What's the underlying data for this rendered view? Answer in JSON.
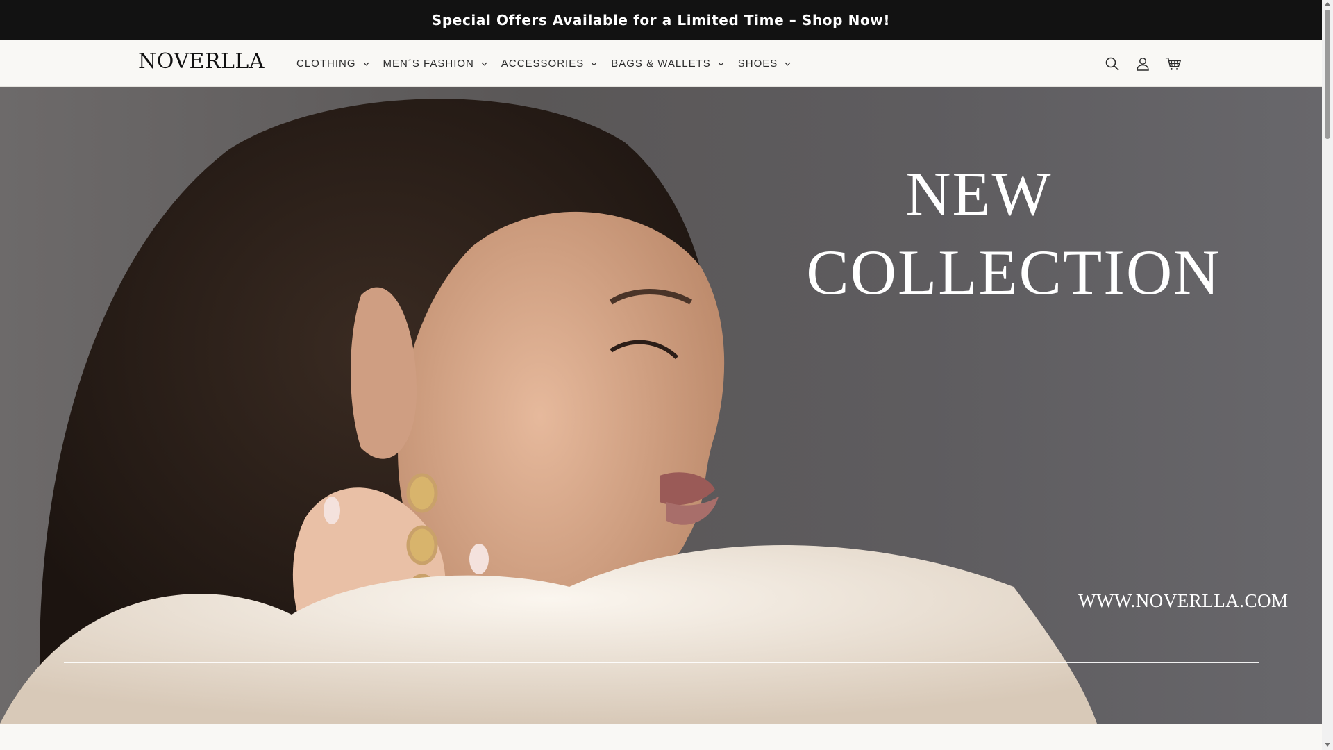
{
  "announcement": {
    "text": "Special Offers Available for a Limited Time – Shop Now!"
  },
  "header": {
    "logo": "NOVERLLA",
    "nav": [
      {
        "label": "CLOTHING",
        "icon": "chevron-down-icon"
      },
      {
        "label": "MEN´S FASHION",
        "icon": "chevron-down-icon"
      },
      {
        "label": "ACCESSORIES",
        "icon": "chevron-down-icon"
      },
      {
        "label": "BAGS & WALLETS",
        "icon": "chevron-down-icon"
      },
      {
        "label": "SHOES",
        "icon": "chevron-down-icon"
      }
    ],
    "icons": [
      "search-icon",
      "account-icon",
      "cart-icon"
    ]
  },
  "hero": {
    "headline_line1": "NEW",
    "headline_line2": "COLLECTION",
    "url": "WWW.NOVERLLA.COM",
    "image": "woman-with-drop-earrings-and-fur-coat"
  },
  "colors": {
    "announcement_bg": "#121212",
    "header_bg": "#f9f8f5",
    "text": "#2b2b2b",
    "hero_text": "#ffffff"
  }
}
